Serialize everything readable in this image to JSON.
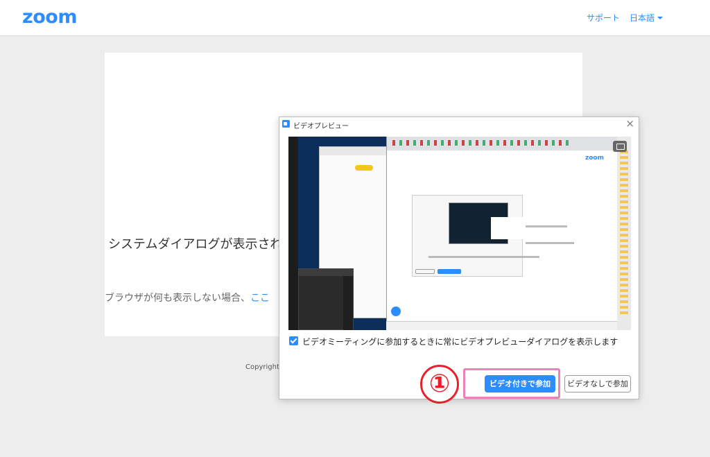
{
  "header": {
    "logo": "zoom",
    "nav": {
      "support": "サポート",
      "language": "日本語"
    }
  },
  "page": {
    "heading": "システムダイアログが表示され",
    "sub_text": "ブラウザが何も表示しない場合、",
    "sub_link": "ここ",
    "copyright": "Copyright ©"
  },
  "dialog": {
    "title": "ビデオプレビュー",
    "preview_logo": "zoom",
    "checkbox_label": "ビデオミーティングに参加するときに常にビデオプレビューダイアログを表示します",
    "checkbox_checked": true,
    "join_with_video": "ビデオ付きで参加",
    "join_without_video": "ビデオなしで参加"
  },
  "annotation": {
    "step_number": "①"
  },
  "colors": {
    "brand": "#2d8cff",
    "highlight": "#ec82b8",
    "step_red": "#e8202b"
  }
}
